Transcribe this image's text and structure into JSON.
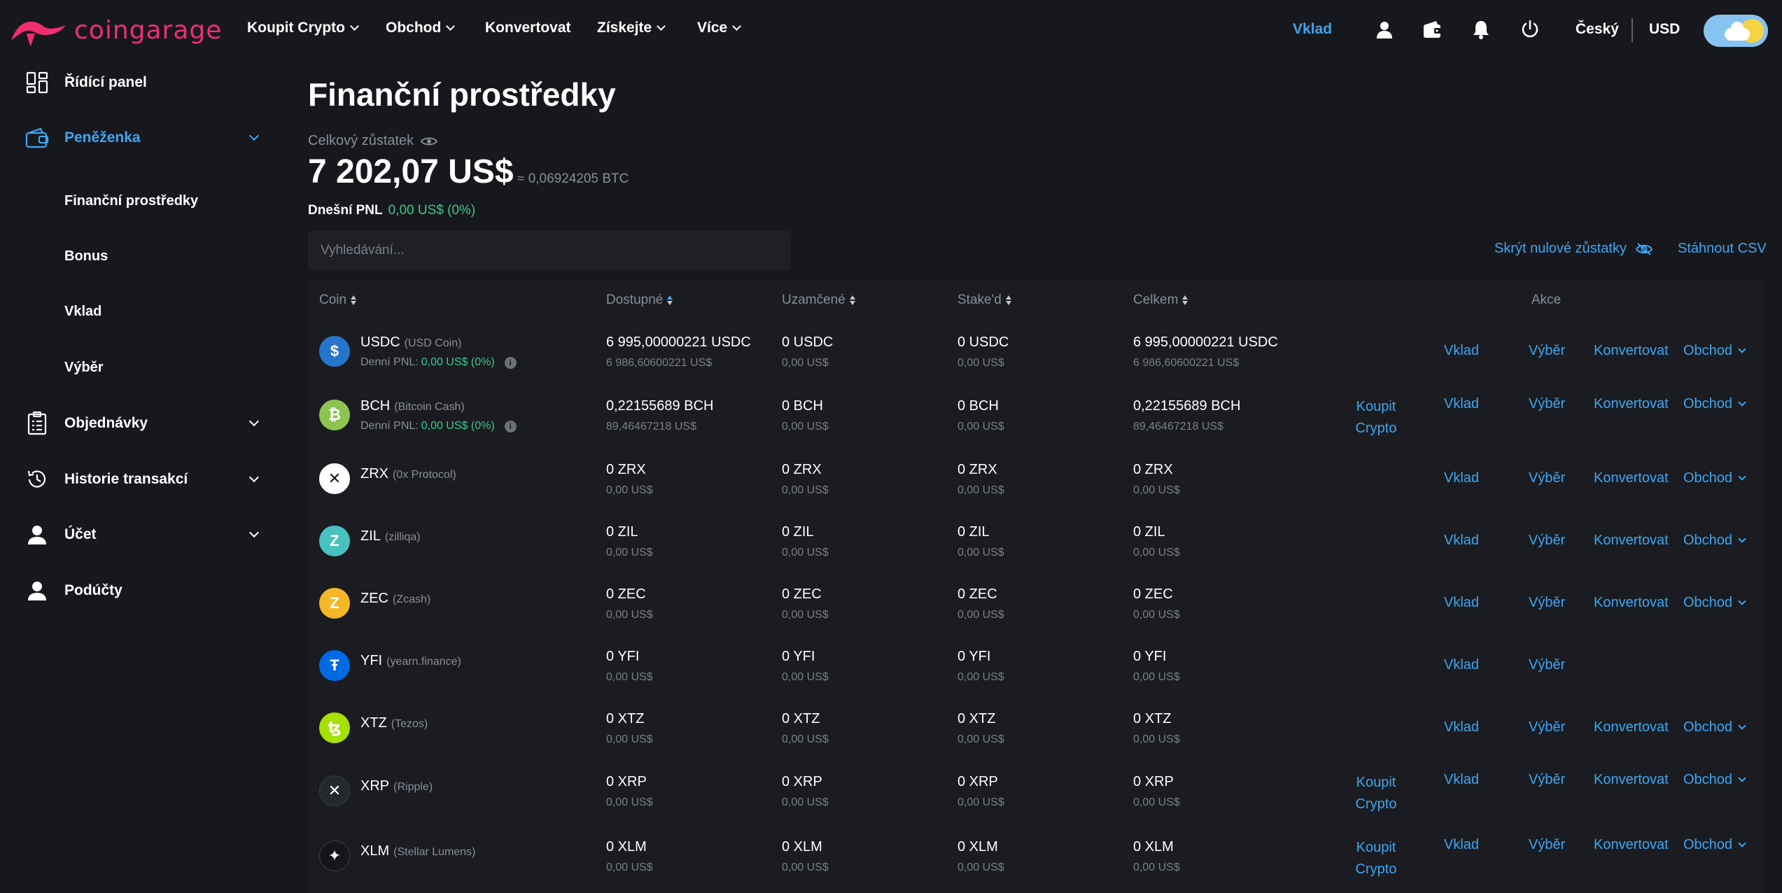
{
  "header": {
    "logo_text": "coingarage",
    "nav": [
      {
        "label": "Koupit Crypto",
        "dropdown": true
      },
      {
        "label": "Obchod",
        "dropdown": true
      },
      {
        "label": "Konvertovat",
        "dropdown": false
      },
      {
        "label": "Získejte",
        "dropdown": true
      },
      {
        "label": "Více",
        "dropdown": true
      }
    ],
    "deposit_label": "Vklad",
    "language": "Český",
    "currency": "USD",
    "icons": [
      "user-icon",
      "wallet-icon",
      "bell-icon",
      "power-icon"
    ],
    "theme_toggle": "day"
  },
  "sidebar": {
    "items": [
      {
        "label": "Řídící panel",
        "icon": "dashboard-icon"
      },
      {
        "label": "Peněženka",
        "icon": "wallet-icon",
        "active": true,
        "expanded": true
      },
      {
        "label": "Objednávky",
        "icon": "orders-icon"
      },
      {
        "label": "Historie transakcí",
        "icon": "history-icon"
      },
      {
        "label": "Účet",
        "icon": "account-icon"
      },
      {
        "label": "Podúčty",
        "icon": "subaccount-icon"
      }
    ],
    "wallet_sub": [
      "Finanční prostředky",
      "Bonus",
      "Vklad",
      "Výběr"
    ]
  },
  "main": {
    "title": "Finanční prostředky",
    "balance_label": "Celkový zůstatek",
    "balance_amount": "7 202,07 US$",
    "balance_btc": "≈ 0,06924205 BTC",
    "pnl_label": "Dnešní PNL",
    "pnl_value": "0,00 US$ (0%)",
    "search_placeholder": "Vyhledávání...",
    "hide_zero_label": "Skrýt nulové zůstatky",
    "csv_label": "Stáhnout CSV"
  },
  "table": {
    "headers": {
      "coin": "Coin",
      "available": "Dostupné",
      "locked": "Uzamčené",
      "staked": "Stake'd",
      "total": "Celkem",
      "actions": "Akce"
    },
    "action_labels": {
      "buy": "Koupit Crypto",
      "buy_line1": "Koupit",
      "buy_line2": "Crypto",
      "deposit": "Vklad",
      "withdraw": "Výběr",
      "convert": "Konvertovat",
      "trade": "Obchod"
    },
    "pnl_prefix": "Denní PNL:",
    "rows": [
      {
        "symbol": "USDC",
        "name": "(USD Coin)",
        "color": "#2775ca",
        "glyph": "$",
        "pnl": "0,00 US$ (0%)",
        "available": "6 995,00000221 USDC",
        "available_usd": "6 986,60600221 US$",
        "locked": "0 USDC",
        "locked_usd": "0,00 US$",
        "staked": "0 USDC",
        "staked_usd": "0,00 US$",
        "total": "6 995,00000221 USDC",
        "total_usd": "6 986,60600221 US$",
        "buy": false,
        "trade": true
      },
      {
        "symbol": "BCH",
        "name": "(Bitcoin Cash)",
        "color": "#8dc351",
        "glyph": "₿",
        "pnl": "0,00 US$ (0%)",
        "available": "0,22155689 BCH",
        "available_usd": "89,46467218 US$",
        "locked": "0 BCH",
        "locked_usd": "0,00 US$",
        "staked": "0 BCH",
        "staked_usd": "0,00 US$",
        "total": "0,22155689 BCH",
        "total_usd": "89,46467218 US$",
        "buy": true,
        "trade": true
      },
      {
        "symbol": "ZRX",
        "name": "(0x Protocol)",
        "color": "#ffffff",
        "glyph": "✕",
        "pnl": "",
        "available": "0 ZRX",
        "available_usd": "0,00 US$",
        "locked": "0 ZRX",
        "locked_usd": "0,00 US$",
        "staked": "0 ZRX",
        "staked_usd": "0,00 US$",
        "total": "0 ZRX",
        "total_usd": "0,00 US$",
        "buy": false,
        "trade": true
      },
      {
        "symbol": "ZIL",
        "name": "(zilliqa)",
        "color": "#49c1bf",
        "glyph": "Z",
        "pnl": "",
        "available": "0 ZIL",
        "available_usd": "0,00 US$",
        "locked": "0 ZIL",
        "locked_usd": "0,00 US$",
        "staked": "0 ZIL",
        "staked_usd": "0,00 US$",
        "total": "0 ZIL",
        "total_usd": "0,00 US$",
        "buy": false,
        "trade": true
      },
      {
        "symbol": "ZEC",
        "name": "(Zcash)",
        "color": "#f4b728",
        "glyph": "Z",
        "pnl": "",
        "available": "0 ZEC",
        "available_usd": "0,00 US$",
        "locked": "0 ZEC",
        "locked_usd": "0,00 US$",
        "staked": "0 ZEC",
        "staked_usd": "0,00 US$",
        "total": "0 ZEC",
        "total_usd": "0,00 US$",
        "buy": false,
        "trade": true
      },
      {
        "symbol": "YFI",
        "name": "(yearn.finance)",
        "color": "#006ae3",
        "glyph": "Ŧ",
        "pnl": "",
        "available": "0 YFI",
        "available_usd": "0,00 US$",
        "locked": "0 YFI",
        "locked_usd": "0,00 US$",
        "staked": "0 YFI",
        "staked_usd": "0,00 US$",
        "total": "0 YFI",
        "total_usd": "0,00 US$",
        "buy": false,
        "trade": false
      },
      {
        "symbol": "XTZ",
        "name": "(Tezos)",
        "color": "#a6e000",
        "glyph": "ꜩ",
        "pnl": "",
        "available": "0 XTZ",
        "available_usd": "0,00 US$",
        "locked": "0 XTZ",
        "locked_usd": "0,00 US$",
        "staked": "0 XTZ",
        "staked_usd": "0,00 US$",
        "total": "0 XTZ",
        "total_usd": "0,00 US$",
        "buy": false,
        "trade": true
      },
      {
        "symbol": "XRP",
        "name": "(Ripple)",
        "color": "#23292f",
        "glyph": "✕",
        "pnl": "",
        "available": "0 XRP",
        "available_usd": "0,00 US$",
        "locked": "0 XRP",
        "locked_usd": "0,00 US$",
        "staked": "0 XRP",
        "staked_usd": "0,00 US$",
        "total": "0 XRP",
        "total_usd": "0,00 US$",
        "buy": true,
        "trade": true
      },
      {
        "symbol": "XLM",
        "name": "(Stellar Lumens)",
        "color": "#14161b",
        "glyph": "✦",
        "pnl": "",
        "available": "0 XLM",
        "available_usd": "0,00 US$",
        "locked": "0 XLM",
        "locked_usd": "0,00 US$",
        "staked": "0 XLM",
        "staked_usd": "0,00 US$",
        "total": "0 XLM",
        "total_usd": "0,00 US$",
        "buy": true,
        "trade": true
      }
    ]
  }
}
